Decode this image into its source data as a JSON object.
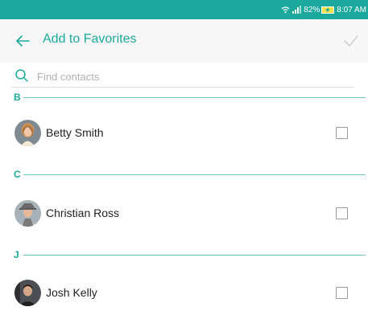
{
  "status_bar": {
    "battery_percent": "82%",
    "time": "8:07 AM",
    "icons": [
      "wifi-icon",
      "signal-icon",
      "battery-charging-icon"
    ]
  },
  "header": {
    "title": "Add to Favorites",
    "back_icon": "arrow-left-icon",
    "confirm_icon": "check-icon"
  },
  "search": {
    "placeholder": "Find contacts",
    "value": "",
    "icon": "search-icon"
  },
  "sections": [
    {
      "letter": "B",
      "contacts": [
        {
          "name": "Betty Smith",
          "checked": false
        }
      ]
    },
    {
      "letter": "C",
      "contacts": [
        {
          "name": "Christian Ross",
          "checked": false
        }
      ]
    },
    {
      "letter": "J",
      "contacts": [
        {
          "name": "Josh Kelly",
          "checked": false
        }
      ]
    }
  ],
  "colors": {
    "accent": "#1aa99c",
    "divider": "#6ec8bf",
    "header_bg": "#f7f7f7"
  }
}
